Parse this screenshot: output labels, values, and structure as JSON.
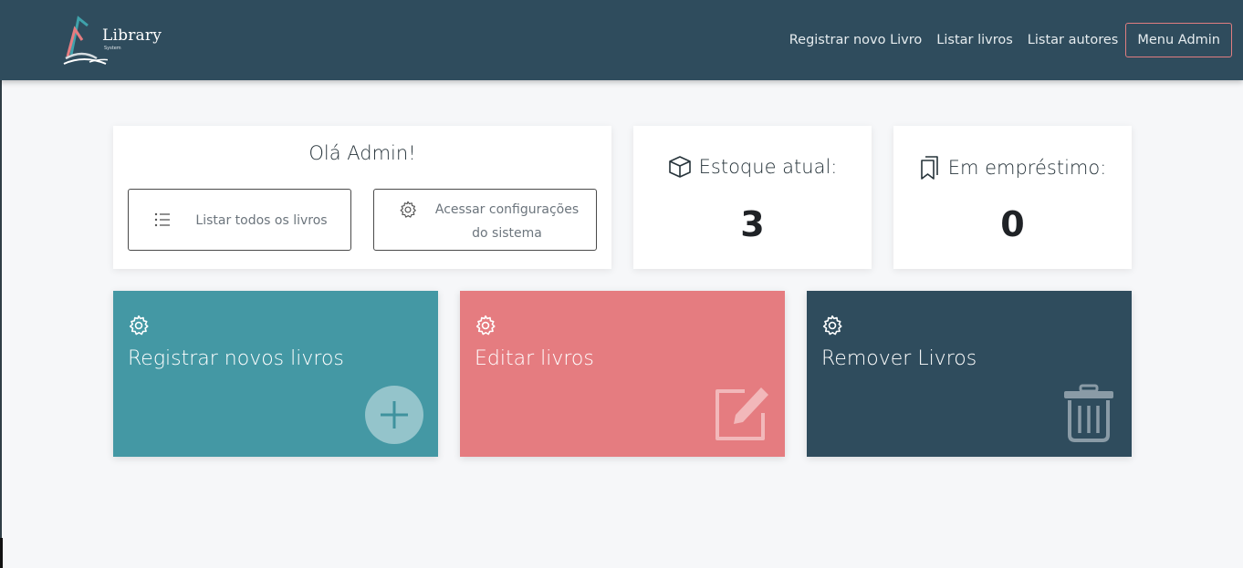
{
  "navbar": {
    "logo": {
      "name": "Library",
      "sub": "System"
    },
    "links": [
      "Registrar novo Livro",
      "Listar livros",
      "Listar autores"
    ],
    "admin_button": "Menu Admin"
  },
  "welcome": {
    "title": "Olá Admin!",
    "buttons": [
      {
        "label": "Listar todos os livros",
        "icon": "list-icon"
      },
      {
        "label": "Acessar configurações do sistema",
        "icon": "gear-icon"
      }
    ]
  },
  "stats": [
    {
      "label": "Estoque atual:",
      "value": "3",
      "icon": "box-icon"
    },
    {
      "label": "Em empréstimo:",
      "value": "0",
      "icon": "bookmarks-icon"
    }
  ],
  "tiles": [
    {
      "title": "Registrar novos livros",
      "icon": "plus-circle-icon",
      "color": "#4498a4"
    },
    {
      "title": "Editar livros",
      "icon": "edit-icon",
      "color": "#e57c80"
    },
    {
      "title": "Remover Livros",
      "icon": "trash-icon",
      "color": "#2f4c5d"
    }
  ],
  "colors": {
    "navbar": "#2f4c5d",
    "accent": "#e07d80",
    "page_bg": "#f6f7f9"
  }
}
